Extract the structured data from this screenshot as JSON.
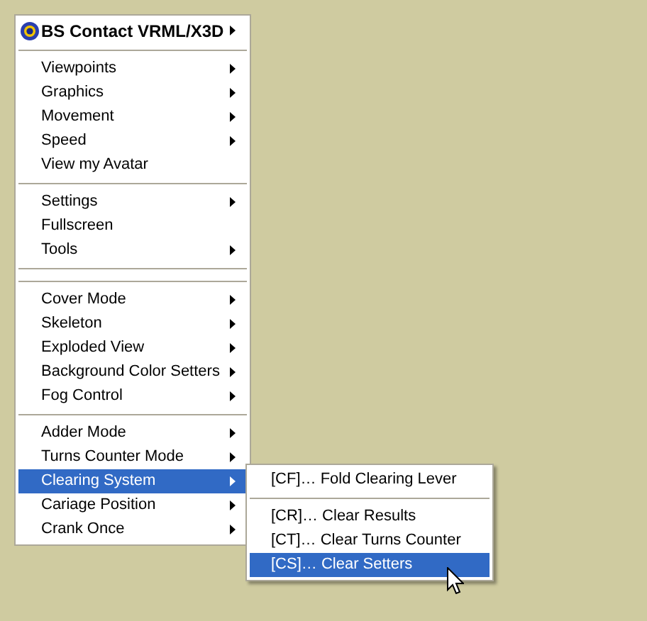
{
  "menu": [
    {
      "kind": "header",
      "label": "BS Contact VRML/X3D",
      "submenu": true,
      "selected": false
    },
    {
      "kind": "separator"
    },
    {
      "kind": "item",
      "label": "Viewpoints",
      "submenu": true,
      "selected": false
    },
    {
      "kind": "item",
      "label": "Graphics",
      "submenu": true,
      "selected": false
    },
    {
      "kind": "item",
      "label": "Movement",
      "submenu": true,
      "selected": false
    },
    {
      "kind": "item",
      "label": "Speed",
      "submenu": true,
      "selected": false
    },
    {
      "kind": "item",
      "label": "View my Avatar",
      "submenu": false,
      "selected": false
    },
    {
      "kind": "separator"
    },
    {
      "kind": "item",
      "label": "Settings",
      "submenu": true,
      "selected": false
    },
    {
      "kind": "item",
      "label": "Fullscreen",
      "submenu": false,
      "selected": false
    },
    {
      "kind": "item",
      "label": "Tools",
      "submenu": true,
      "selected": false
    },
    {
      "kind": "separator"
    },
    {
      "kind": "separator"
    },
    {
      "kind": "item",
      "label": "Cover Mode",
      "submenu": true,
      "selected": false
    },
    {
      "kind": "item",
      "label": "Skeleton",
      "submenu": true,
      "selected": false
    },
    {
      "kind": "item",
      "label": "Exploded View",
      "submenu": true,
      "selected": false
    },
    {
      "kind": "item",
      "label": "Background Color Setters",
      "submenu": true,
      "selected": false
    },
    {
      "kind": "item",
      "label": "Fog Control",
      "submenu": true,
      "selected": false
    },
    {
      "kind": "separator"
    },
    {
      "kind": "item",
      "label": "Adder Mode",
      "submenu": true,
      "selected": false
    },
    {
      "kind": "item",
      "label": "Turns Counter Mode",
      "submenu": true,
      "selected": false
    },
    {
      "kind": "item",
      "label": "Clearing System",
      "submenu": true,
      "selected": true
    },
    {
      "kind": "item",
      "label": "Cariage Position",
      "submenu": true,
      "selected": false
    },
    {
      "kind": "item",
      "label": "Crank Once",
      "submenu": true,
      "selected": false
    }
  ],
  "submenu": [
    {
      "kind": "item",
      "label": "[CF]… Fold Clearing Lever",
      "selected": false
    },
    {
      "kind": "separator"
    },
    {
      "kind": "item",
      "label": "[CR]… Clear Results",
      "selected": false
    },
    {
      "kind": "item",
      "label": "[CT]… Clear Turns Counter",
      "selected": false
    },
    {
      "kind": "item",
      "label": "[CS]… Clear Setters",
      "selected": true
    }
  ]
}
